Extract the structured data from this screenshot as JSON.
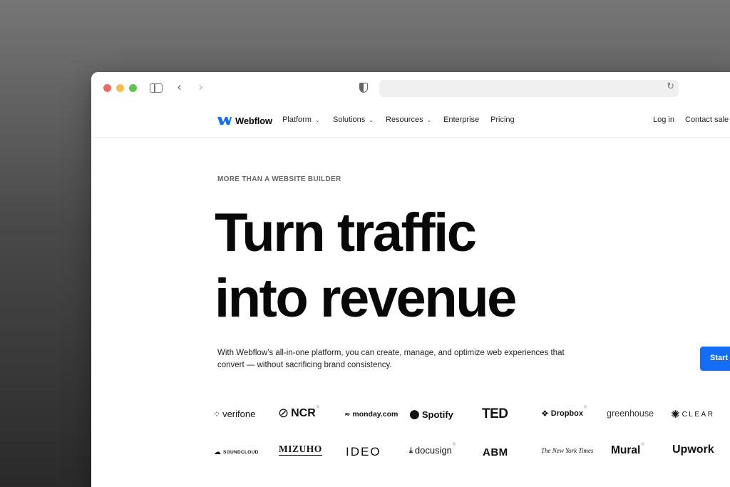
{
  "nav": {
    "brand": "Webflow",
    "items": [
      {
        "label": "Platform",
        "has_dropdown": true
      },
      {
        "label": "Solutions",
        "has_dropdown": true
      },
      {
        "label": "Resources",
        "has_dropdown": true
      },
      {
        "label": "Enterprise",
        "has_dropdown": false
      },
      {
        "label": "Pricing",
        "has_dropdown": false
      }
    ],
    "login": "Log in",
    "contact": "Contact sale"
  },
  "hero": {
    "eyebrow": "MORE THAN A WEBSITE BUILDER",
    "headline_line1": "Turn traffic",
    "headline_line2": "into revenue",
    "subtext": "With Webflow’s all-in-one platform, you can create, manage, and optimize web experiences that convert — without sacrificing brand consistency.",
    "cta": "Start"
  },
  "logos": {
    "row1": [
      "verifone",
      "NCR",
      "monday.com",
      "Spotify",
      "TED",
      "Dropbox",
      "greenhouse",
      "CLEAR"
    ],
    "row2": [
      "SOUNDCLOUD",
      "MIZUHO",
      "IDEO",
      "docusign",
      "ABM",
      "The New York Times",
      "Mural",
      "Upwork"
    ]
  },
  "colors": {
    "accent": "#146ef5",
    "text": "#080808"
  },
  "icons": {
    "sidebar": "sidebar-icon",
    "back": "chevron-left-icon",
    "forward": "chevron-right-icon",
    "privacy": "shield-icon",
    "reload": "reload-icon"
  }
}
